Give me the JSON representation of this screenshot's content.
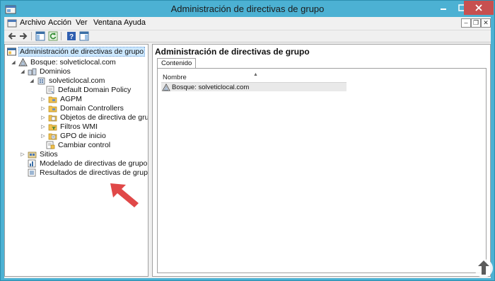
{
  "window": {
    "title": "Administración de directivas de grupo"
  },
  "menu": {
    "items": [
      "Archivo",
      "Acción",
      "Ver",
      "Ventana",
      "Ayuda"
    ]
  },
  "tree": {
    "items": [
      {
        "label": "Administración de directivas de grupo",
        "level": 0,
        "expander": "",
        "icon": "gpmc-icon",
        "selected": true
      },
      {
        "label": "Bosque: solveticlocal.com",
        "level": 1,
        "expander": "open",
        "icon": "forest-icon"
      },
      {
        "label": "Dominios",
        "level": 2,
        "expander": "open",
        "icon": "domains-icon"
      },
      {
        "label": "solveticlocal.com",
        "level": 3,
        "expander": "open",
        "icon": "domain-icon"
      },
      {
        "label": "Default Domain Policy",
        "level": 4,
        "expander": "",
        "icon": "gpo-link-icon"
      },
      {
        "label": "AGPM",
        "level": 4,
        "expander": "closed",
        "icon": "ou-folder-icon"
      },
      {
        "label": "Domain Controllers",
        "level": 4,
        "expander": "closed",
        "icon": "ou-folder-icon"
      },
      {
        "label": "Objetos de directiva de grupo",
        "level": 4,
        "expander": "closed",
        "icon": "gpo-folder-icon"
      },
      {
        "label": "Filtros WMI",
        "level": 4,
        "expander": "closed",
        "icon": "wmi-folder-icon"
      },
      {
        "label": "GPO de inicio",
        "level": 4,
        "expander": "closed",
        "icon": "starter-gpo-folder-icon"
      },
      {
        "label": "Cambiar control",
        "level": 4,
        "expander": "",
        "icon": "change-control-icon"
      },
      {
        "label": "Sitios",
        "level": 1,
        "expander": "closed",
        "icon": "sites-icon"
      },
      {
        "label": "Modelado de directivas de grupo",
        "level": 1,
        "expander": "",
        "icon": "modeling-icon"
      },
      {
        "label": "Resultados de directivas de grupo",
        "level": 1,
        "expander": "",
        "icon": "results-icon"
      }
    ]
  },
  "right_pane": {
    "title": "Administración de directivas de grupo",
    "tab_label": "Contenido",
    "column_header": "Nombre",
    "rows": [
      "Bosque: solveticlocal.com"
    ]
  },
  "colors": {
    "title_bar": "#4cb1d3",
    "close_button": "#c75050",
    "selection": "#cce8ff",
    "annotation_arrow": "#e04848"
  }
}
